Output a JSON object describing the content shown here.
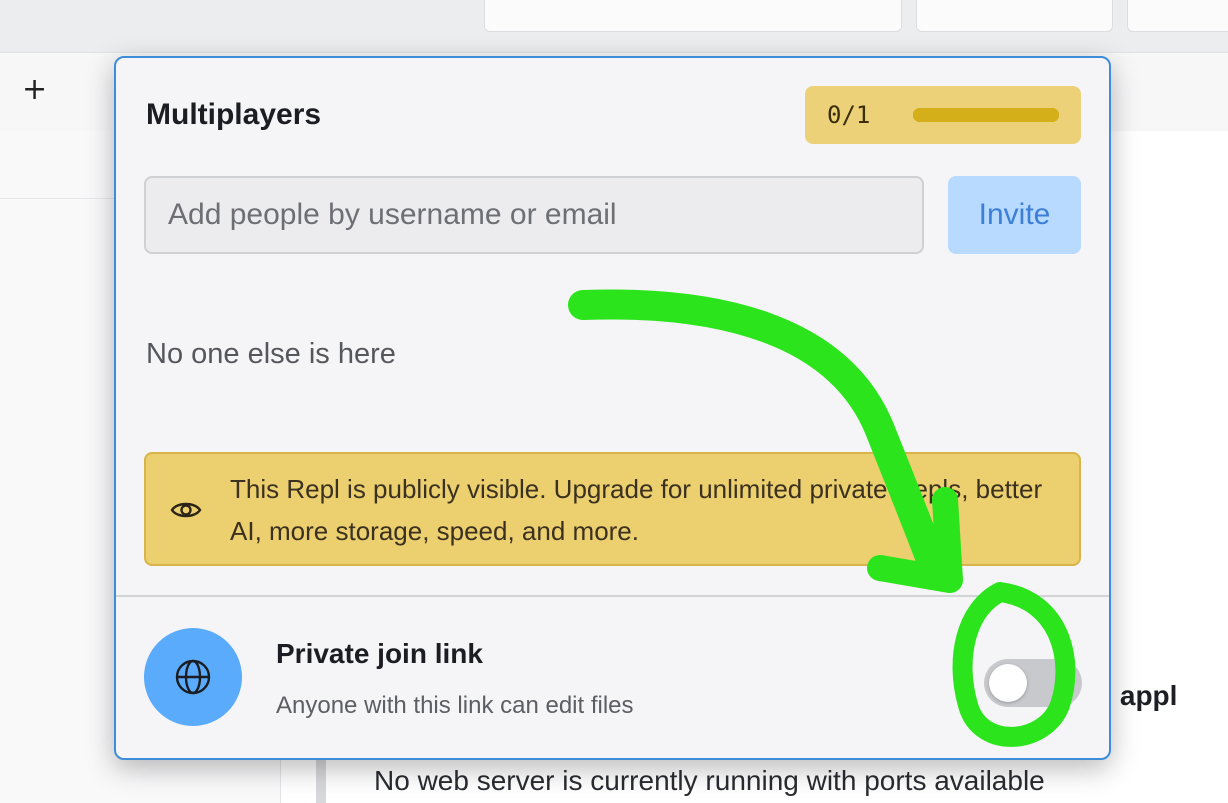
{
  "toolbar": {
    "new_tab_symbol": "+"
  },
  "multiplayer_panel": {
    "title": "Multiplayers",
    "usage": {
      "count_label": "0/1",
      "used": 0,
      "limit": 1,
      "meter_fill_fraction": 1.0,
      "meter_color": "#d4af1a"
    },
    "invite": {
      "placeholder": "Add people by username or email",
      "value": "",
      "button_label": "Invite"
    },
    "empty_message": "No one else is here",
    "visibility_notice": {
      "icon": "eye-icon",
      "text": "This Repl is publicly visible. Upgrade for unlimited private Repls, better AI, more storage, speed, and more."
    },
    "private_join_link": {
      "icon": "globe-icon",
      "title": "Private join link",
      "description": "Anyone with this link can edit files",
      "enabled": false
    }
  },
  "background": {
    "heading_fragment": "b appl",
    "message_fragment": "No web server is currently running with ports available"
  },
  "colors": {
    "accent_blue": "#3e8ddb",
    "warning_yellow": "#eccf6e",
    "annotation_green": "#2be41c"
  }
}
